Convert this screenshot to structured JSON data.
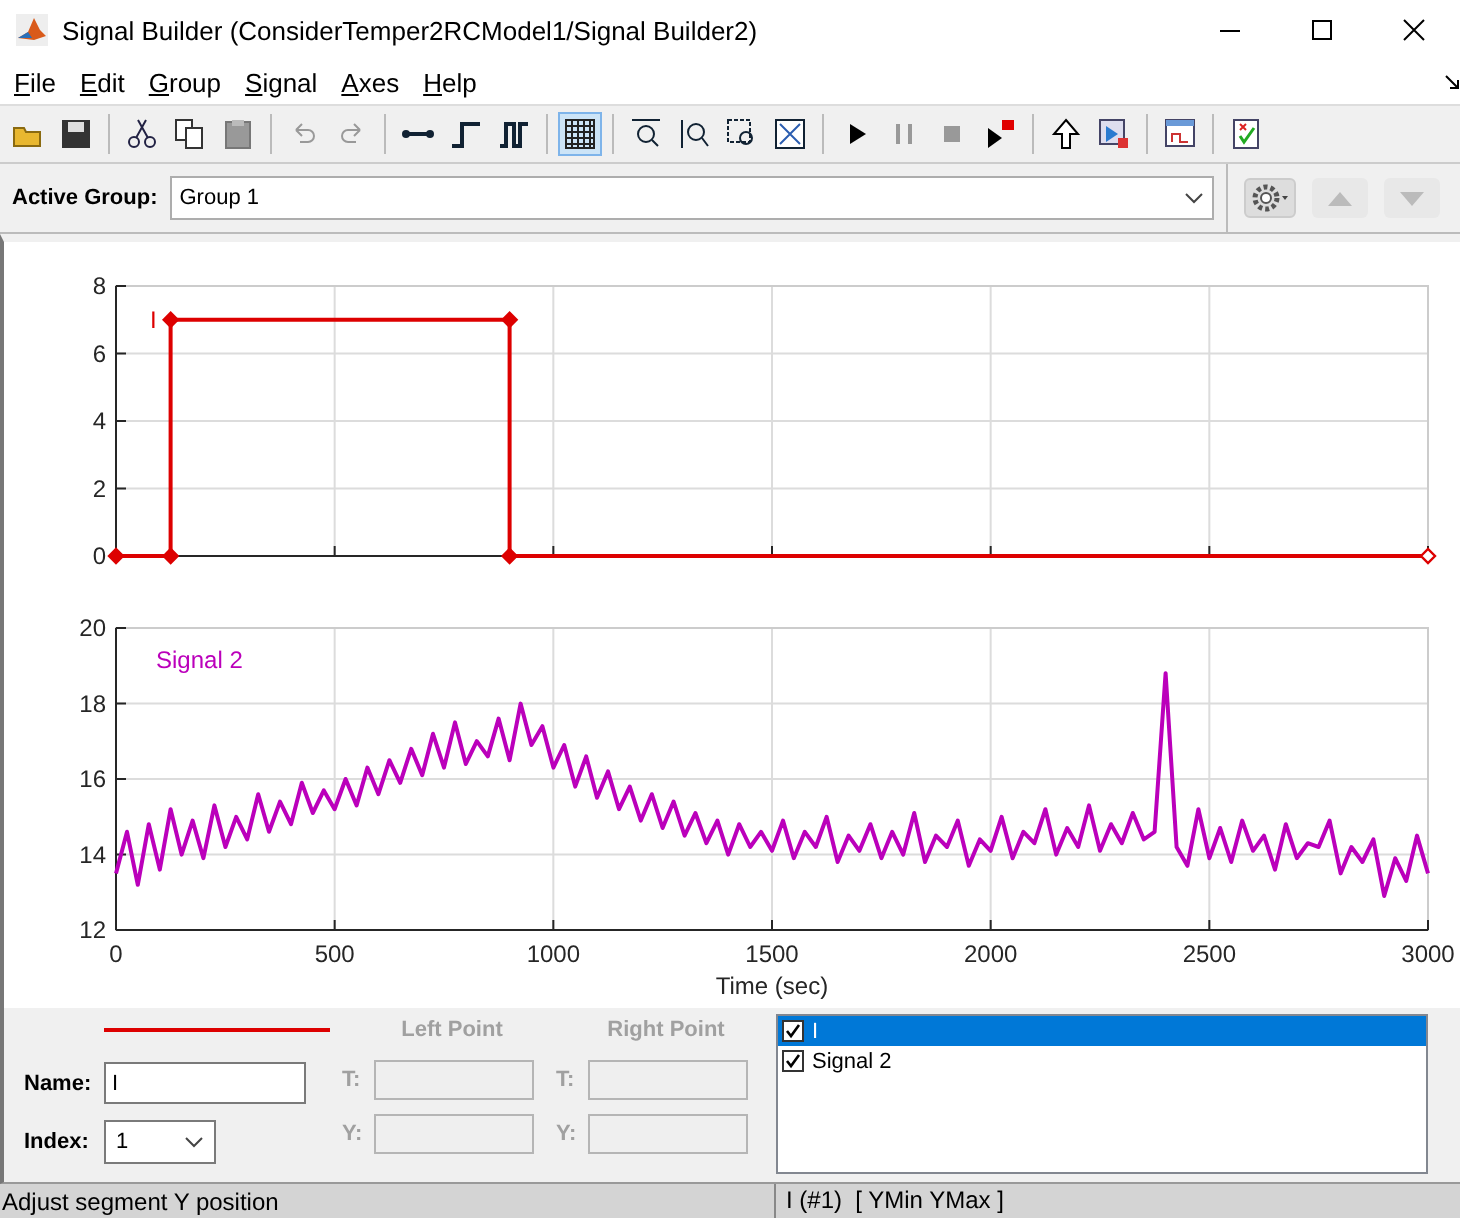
{
  "window": {
    "title": "Signal Builder (ConsiderTemper2RCModel1/Signal Builder2)"
  },
  "menu": [
    {
      "label": "File"
    },
    {
      "label": "Edit"
    },
    {
      "label": "Group"
    },
    {
      "label": "Signal"
    },
    {
      "label": "Axes"
    },
    {
      "label": "Help"
    }
  ],
  "toolbar": {
    "grid_on": true
  },
  "active_group": {
    "label": "Active Group:",
    "value": "Group 1"
  },
  "charts": [
    {
      "chart_data": {
        "type": "line",
        "x": [
          0,
          125,
          125,
          900,
          900,
          3000
        ],
        "series": [
          {
            "name": "I",
            "color": "#dd0000",
            "marker": "diamond",
            "values": [
              0,
              0,
              7,
              7,
              0,
              0
            ]
          }
        ],
        "xlim": [
          0,
          3000
        ],
        "ylim": [
          0,
          8
        ],
        "yticks": [
          0,
          2,
          4,
          6,
          8
        ],
        "grid": true
      }
    },
    {
      "chart_data": {
        "type": "line",
        "xlabel": "Time (sec)",
        "x": [
          0,
          25,
          50,
          75,
          100,
          125,
          150,
          175,
          200,
          225,
          250,
          275,
          300,
          325,
          350,
          375,
          400,
          425,
          450,
          475,
          500,
          525,
          550,
          575,
          600,
          625,
          650,
          675,
          700,
          725,
          750,
          775,
          800,
          825,
          850,
          875,
          900,
          925,
          950,
          975,
          1000,
          1025,
          1050,
          1075,
          1100,
          1125,
          1150,
          1175,
          1200,
          1225,
          1250,
          1275,
          1300,
          1325,
          1350,
          1375,
          1400,
          1425,
          1450,
          1475,
          1500,
          1525,
          1550,
          1575,
          1600,
          1625,
          1650,
          1675,
          1700,
          1725,
          1750,
          1775,
          1800,
          1825,
          1850,
          1875,
          1900,
          1925,
          1950,
          1975,
          2000,
          2025,
          2050,
          2075,
          2100,
          2125,
          2150,
          2175,
          2200,
          2225,
          2250,
          2275,
          2300,
          2325,
          2350,
          2375,
          2400,
          2425,
          2450,
          2475,
          2500,
          2525,
          2550,
          2575,
          2600,
          2625,
          2650,
          2675,
          2700,
          2725,
          2750,
          2775,
          2800,
          2825,
          2850,
          2875,
          2900,
          2925,
          2950,
          2975,
          3000
        ],
        "series": [
          {
            "name": "Signal 2",
            "color": "#bb00bb",
            "values": [
              13.5,
              14.6,
              13.2,
              14.8,
              13.6,
              15.2,
              14.0,
              14.9,
              13.9,
              15.3,
              14.2,
              15.0,
              14.4,
              15.6,
              14.6,
              15.4,
              14.8,
              15.9,
              15.1,
              15.7,
              15.2,
              16.0,
              15.3,
              16.3,
              15.6,
              16.5,
              15.9,
              16.8,
              16.1,
              17.2,
              16.3,
              17.5,
              16.4,
              17.0,
              16.6,
              17.6,
              16.5,
              18.0,
              16.9,
              17.4,
              16.3,
              16.9,
              15.8,
              16.6,
              15.5,
              16.2,
              15.2,
              15.8,
              14.9,
              15.6,
              14.7,
              15.4,
              14.5,
              15.1,
              14.3,
              14.9,
              14.0,
              14.8,
              14.2,
              14.6,
              14.1,
              14.9,
              13.9,
              14.6,
              14.2,
              15.0,
              13.8,
              14.5,
              14.1,
              14.8,
              13.9,
              14.6,
              14.0,
              15.1,
              13.8,
              14.5,
              14.2,
              14.9,
              13.7,
              14.4,
              14.1,
              15.0,
              13.9,
              14.6,
              14.3,
              15.2,
              14.0,
              14.7,
              14.2,
              15.3,
              14.1,
              14.8,
              14.3,
              15.1,
              14.4,
              14.6,
              18.8,
              14.2,
              13.7,
              15.2,
              13.9,
              14.7,
              13.8,
              14.9,
              14.1,
              14.5,
              13.6,
              14.8,
              13.9,
              14.3,
              14.2,
              14.9,
              13.5,
              14.2,
              13.8,
              14.4,
              12.9,
              13.9,
              13.3,
              14.5,
              13.5
            ]
          }
        ],
        "xlim": [
          0,
          3000
        ],
        "ylim": [
          12,
          20
        ],
        "xticks": [
          0,
          500,
          1000,
          1500,
          2000,
          2500,
          3000
        ],
        "yticks": [
          12,
          14,
          16,
          18,
          20
        ],
        "grid": true
      }
    }
  ],
  "segment_panel": {
    "left_point": {
      "heading": "Left Point",
      "t_label": "T:",
      "y_label": "Y:",
      "disabled": true
    },
    "right_point": {
      "heading": "Right Point",
      "t_label": "T:",
      "y_label": "Y:",
      "disabled": true
    },
    "name": {
      "label": "Name:",
      "value": "I"
    },
    "index": {
      "label": "Index:",
      "value": "1"
    }
  },
  "signals": [
    {
      "label": "I",
      "checked": true,
      "selected": true
    },
    {
      "label": "Signal 2",
      "checked": true,
      "selected": false
    }
  ],
  "status_bar": {
    "message": "Adjust segment Y position",
    "selection": "I (#1)  [ YMin YMax ]"
  }
}
